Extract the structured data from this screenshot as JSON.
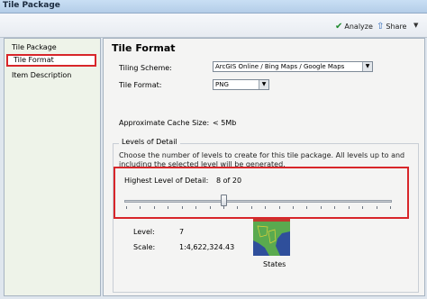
{
  "window": {
    "title": "Tile Package"
  },
  "toolbar": {
    "analyze_label": "Analyze",
    "share_label": "Share"
  },
  "sidebar": {
    "items": [
      {
        "label": "Tile Package"
      },
      {
        "label": "Tile Format"
      },
      {
        "label": "Item Description"
      }
    ]
  },
  "main": {
    "title": "Tile Format",
    "tiling_scheme": {
      "label": "Tiling Scheme:",
      "value": "ArcGIS Online / Bing Maps / Google Maps"
    },
    "tile_format": {
      "label": "Tile Format:",
      "value": "PNG"
    },
    "cache_size": {
      "label": "Approximate Cache Size:",
      "value": "< 5Mb"
    },
    "levels": {
      "group_title": "Levels of Detail",
      "description": "Choose the number of levels to create for this tile package.  All levels up to and including the selected level will be generated.",
      "highest_label": "Highest Level of Detail:",
      "highest_value": "8 of 20",
      "slider_fraction": 0.37,
      "level_label": "Level:",
      "level_value": "7",
      "scale_label": "Scale:",
      "scale_value": "1:4,622,324.43",
      "preview_caption": "States"
    }
  },
  "colors": {
    "highlight": "#d8262a",
    "preview_land": "#5aaa4f",
    "preview_water": "#2f4f9b"
  }
}
